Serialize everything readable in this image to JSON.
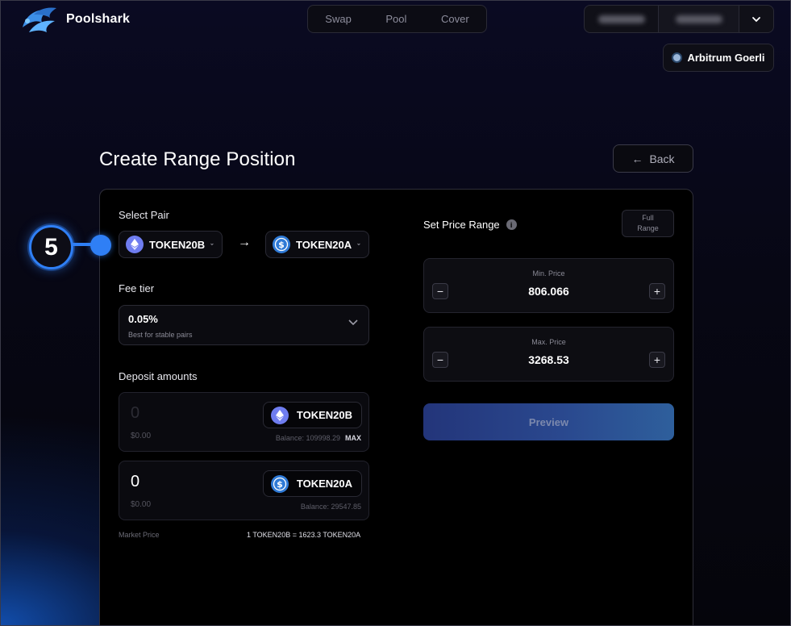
{
  "header": {
    "app_name": "Poolshark",
    "nav": [
      {
        "label": "Swap"
      },
      {
        "label": "Pool"
      },
      {
        "label": "Cover"
      }
    ],
    "network": "Arbitrum Goerli"
  },
  "page": {
    "title": "Create Range Position",
    "back_label": "Back",
    "back_arrow": "←"
  },
  "pair": {
    "label": "Select Pair",
    "token_in": "TOKEN20B",
    "token_out": "TOKEN20A",
    "arrow": "→"
  },
  "fee": {
    "label": "Fee tier",
    "value": "0.05%",
    "description": "Best for stable pairs"
  },
  "deposit": {
    "label": "Deposit amounts",
    "rows": [
      {
        "amount": "0",
        "usd": "$0.00",
        "token": "TOKEN20B",
        "balance": "Balance: 109998.29",
        "max": "MAX"
      },
      {
        "amount": "0",
        "usd": "$0.00",
        "token": "TOKEN20A",
        "balance": "Balance: 29547.85"
      }
    ]
  },
  "market": {
    "label": "Market Price",
    "value": "1 TOKEN20B = 1623.3 TOKEN20A"
  },
  "range": {
    "label": "Set Price Range",
    "info_icon": "i",
    "full_range_label": "Full Range",
    "min": {
      "title": "Min. Price",
      "value": "806.066"
    },
    "max": {
      "title": "Max. Price",
      "value": "3268.53"
    },
    "minus": "−",
    "plus": "+"
  },
  "preview_label": "Preview",
  "annotation": {
    "step": "5"
  },
  "icons": {
    "eth": "ethereum-icon",
    "usd": "usd-coin-icon",
    "accent": "#2f7ff5"
  }
}
